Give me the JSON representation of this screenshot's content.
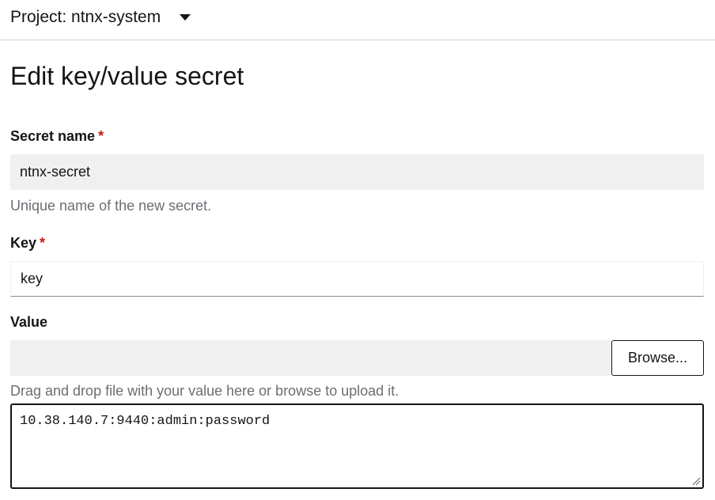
{
  "header": {
    "project_label": "Project: ntnx-system"
  },
  "page": {
    "title": "Edit key/value secret"
  },
  "form": {
    "secret_name": {
      "label": "Secret name",
      "required_mark": "*",
      "value": "ntnx-secret",
      "helper": "Unique name of the new secret."
    },
    "key": {
      "label": "Key",
      "required_mark": "*",
      "value": "key"
    },
    "value": {
      "label": "Value",
      "file_value": "",
      "browse_label": "Browse...",
      "helper": "Drag and drop file with your value here or browse to upload it.",
      "text": "10.38.140.7:9440:admin:password"
    }
  },
  "icons": {
    "project_dropdown": "caret-down-icon",
    "textarea_resize": "resize-handle-icon"
  },
  "colors": {
    "required": "#c9190b",
    "helper_text": "#6a6e73",
    "disabled_field_bg": "#f0f0f0"
  }
}
